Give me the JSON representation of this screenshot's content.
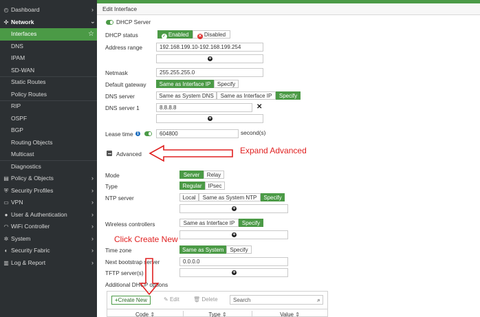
{
  "sidebar": {
    "items": [
      {
        "label": "Dashboard",
        "icon": "dashboard-icon",
        "glyph": "◴"
      },
      {
        "label": "Network",
        "icon": "network-icon",
        "glyph": "✣"
      },
      {
        "label": "Interfaces"
      },
      {
        "label": "DNS"
      },
      {
        "label": "IPAM"
      },
      {
        "label": "SD-WAN"
      },
      {
        "label": "Static Routes"
      },
      {
        "label": "Policy Routes"
      },
      {
        "label": "RIP"
      },
      {
        "label": "OSPF"
      },
      {
        "label": "BGP"
      },
      {
        "label": "Routing Objects"
      },
      {
        "label": "Multicast"
      },
      {
        "label": "Diagnostics"
      },
      {
        "label": "Policy & Objects",
        "icon": "policy-objects-icon",
        "glyph": "▤"
      },
      {
        "label": "Security Profiles",
        "icon": "security-profiles-icon",
        "glyph": "⛨"
      },
      {
        "label": "VPN",
        "icon": "vpn-icon",
        "glyph": "▭"
      },
      {
        "label": "User & Authentication",
        "icon": "user-icon",
        "glyph": "●"
      },
      {
        "label": "WiFi Controller",
        "icon": "wifi-icon",
        "glyph": "◠"
      },
      {
        "label": "System",
        "icon": "system-gear-icon",
        "glyph": "✲"
      },
      {
        "label": "Security Fabric",
        "icon": "security-fabric-icon",
        "glyph": "◐"
      },
      {
        "label": "Log & Report",
        "icon": "log-report-icon",
        "glyph": "▥"
      }
    ],
    "chevron": "›",
    "star": "☆"
  },
  "header": {
    "title": "Edit Interface"
  },
  "dhcp": {
    "section_title": "DHCP Server",
    "status_label": "DHCP status",
    "enabled_label": "Enabled",
    "disabled_label": "Disabled",
    "address_range_label": "Address range",
    "address_range_value": "192.168.199.10-192.168.199.254",
    "netmask_label": "Netmask",
    "netmask_value": "255.255.255.0",
    "default_gateway_label": "Default gateway",
    "gw_same_as_interface": "Same as Interface IP",
    "gw_specify": "Specify",
    "dns_server_label": "DNS server",
    "dns_same_as_system": "Same as System DNS",
    "dns_same_as_interface": "Same as Interface IP",
    "dns_specify": "Specify",
    "dns_server1_label": "DNS server 1",
    "dns_server1_value": "8.8.8.8",
    "lease_time_label": "Lease time",
    "lease_time_value": "604800",
    "lease_time_unit": "second(s)"
  },
  "advanced": {
    "label": "Advanced",
    "mode_label": "Mode",
    "mode_server": "Server",
    "mode_relay": "Relay",
    "type_label": "Type",
    "type_regular": "Regular",
    "type_ipsec": "IPsec",
    "ntp_label": "NTP server",
    "ntp_local": "Local",
    "ntp_same_as_system": "Same as System NTP",
    "ntp_specify": "Specify",
    "wlc_label": "Wireless controllers",
    "wlc_same_as_interface": "Same as Interface IP",
    "wlc_specify": "Specify",
    "tz_label": "Time zone",
    "tz_same_as_system": "Same as System",
    "tz_specify": "Specify",
    "bootstrap_label": "Next bootstrap server",
    "bootstrap_value": "0.0.0.0",
    "tftp_label": "TFTP server(s)",
    "additional_label": "Additional DHCP options"
  },
  "table": {
    "create_new": "Create New",
    "edit": "Edit",
    "delete": "Delete",
    "search_placeholder": "Search",
    "columns": [
      "Code",
      "Type",
      "Value"
    ]
  },
  "annotations": {
    "expand_advanced": "Expand Advanced",
    "click_create_new": "Click Create New"
  },
  "colors": {
    "accent": "#4b9a46",
    "sidebar_bg": "#2c3033",
    "annotation": "#e02020"
  }
}
